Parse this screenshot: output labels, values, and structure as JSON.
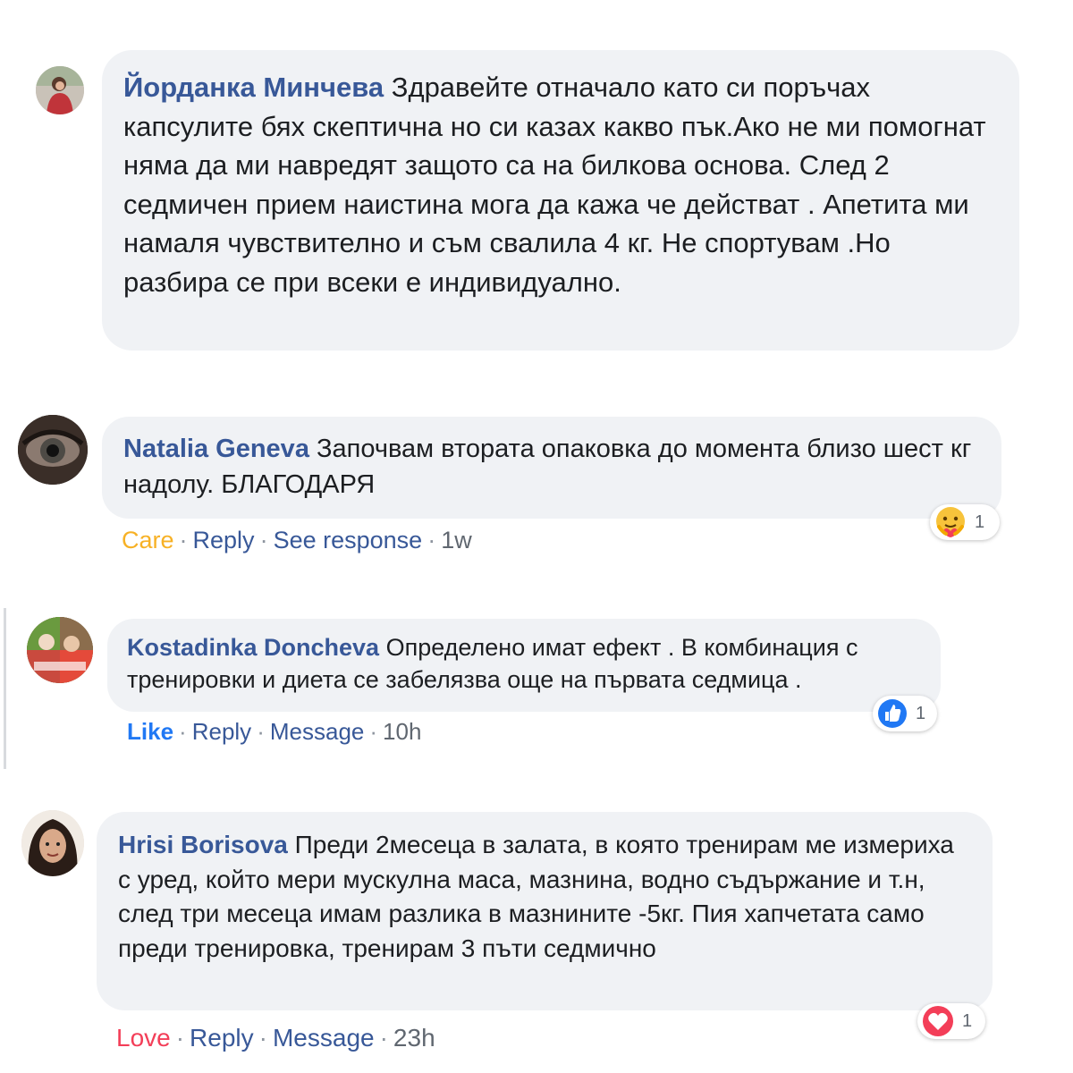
{
  "colors": {
    "bubble": "#f0f2f5",
    "author": "#385898",
    "link": "#385898",
    "care": "#f7b125",
    "like": "#2078f4",
    "love": "#f33e58",
    "muted": "#8d949e"
  },
  "comments": [
    {
      "author": "Йорданка Минчева",
      "text": "Здравейте отначало като си поръчах капсулите бях скептична но си казах какво пък.Ако не ми помогнат няма да ми навредят защото са на билкова основа. След 2 седмичен прием наистина мога да кажа че действат . Апетита ми намаля чувствително и съм свалила 4 кг. Не спортувам .Но разбира се при всеки е индивидуално."
    },
    {
      "author": "Natalia Geneva",
      "text": "Започвам втората опаковка до момента близо шест кг надолу. БЛАГОДАРЯ",
      "actions": {
        "reaction": "Care",
        "reply": "Reply",
        "extra": "See response",
        "time": "1w"
      },
      "reaction_icon": "care-emoji-icon",
      "reaction_count": "1"
    },
    {
      "author": "Kostadinka Doncheva",
      "text": "Определено имат ефект . В комбинация с тренировки и диета се забелязва още на първата седмица .",
      "actions": {
        "reaction": "Like",
        "reply": "Reply",
        "extra": "Message",
        "time": "10h"
      },
      "reaction_icon": "like-thumb-icon",
      "reaction_count": "1"
    },
    {
      "author": "Hrisi Borisova",
      "text": "Преди 2месеца в залата, в която тренирам ме измериха с уред, който мери мускулна маса, мазнина, водно съдържание и т.н, след три месеца имам разлика в мазнините -5кг. Пия хапчетата само преди тренировка, тренирам 3 пъти седмично",
      "actions": {
        "reaction": "Love",
        "reply": "Reply",
        "extra": "Message",
        "time": "23h"
      },
      "reaction_icon": "love-heart-icon",
      "reaction_count": "1"
    }
  ]
}
